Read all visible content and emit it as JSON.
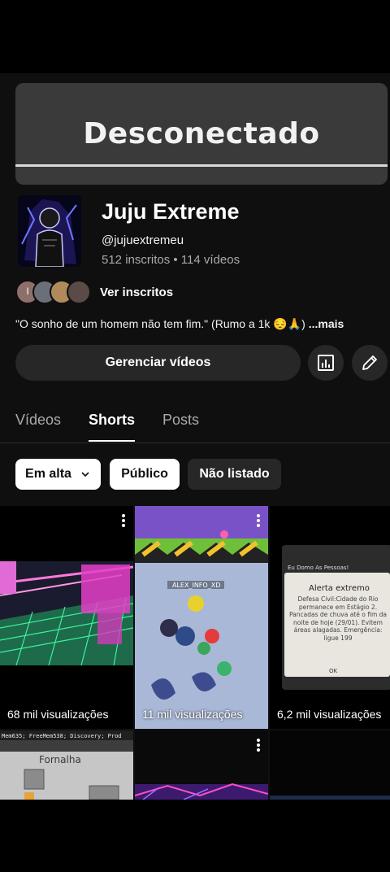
{
  "banner": {
    "text": "Desconectado"
  },
  "channel": {
    "name": "Juju Extreme",
    "handle": "@jujuextremeu",
    "stats": "512 inscritos • 114 vídeos",
    "see_subscribers": "Ver inscritos",
    "subscriber_avatars": [
      "I",
      "",
      "",
      ""
    ],
    "bio": "\"O sonho de um homem não tem fim.\" (Rumo a 1k 😔🙏)",
    "bio_more": "...mais"
  },
  "actions": {
    "manage_videos": "Gerenciar vídeos"
  },
  "tabs": [
    {
      "label": "Vídeos",
      "active": false
    },
    {
      "label": "Shorts",
      "active": true
    },
    {
      "label": "Posts",
      "active": false
    }
  ],
  "filters": [
    {
      "label": "Em alta",
      "selected": true
    },
    {
      "label": "Público",
      "selected": true
    },
    {
      "label": "Não listado",
      "selected": false
    }
  ],
  "shorts": [
    {
      "views": "68 mil visualizações"
    },
    {
      "views": "11 mil visualizações"
    },
    {
      "views": "6,2 mil visualizações"
    },
    {
      "views": ""
    },
    {
      "views": ""
    },
    {
      "views": ""
    }
  ],
  "thumb_text": {
    "alert_title": "Alerta extremo",
    "alert_body": "Defesa Civil:Cidade do Rio permanece em Estágio 2. Pancadas de chuva até o fim da noite de hoje (29/01). Evitem áreas alagadas. Emergência: ligue 199",
    "alert_ok": "OK",
    "alert_header": "Eu Domo As Pessoas!",
    "game_bar": "Mem635; FreeMem538; Discovery; Prod",
    "furnace": "Fornalha",
    "player_tag": "ALEX_INFO_XD"
  },
  "colors": {
    "background": "#0f0f0f",
    "chip_dark": "#272727",
    "secondary_text": "#aaaaaa"
  }
}
